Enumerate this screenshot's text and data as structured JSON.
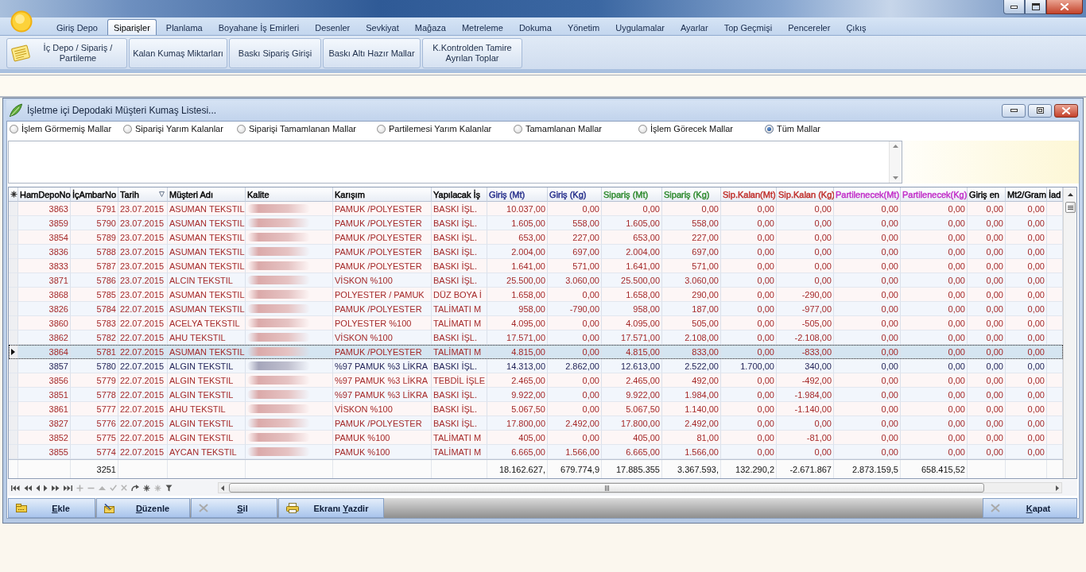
{
  "menu": {
    "tabs": [
      {
        "label": "Giriş Depo",
        "selected": false
      },
      {
        "label": "Siparişler",
        "selected": true
      },
      {
        "label": "Planlama",
        "selected": false
      },
      {
        "label": "Boyahane İş Emirleri",
        "selected": false
      },
      {
        "label": "Desenler",
        "selected": false
      },
      {
        "label": "Sevkiyat",
        "selected": false
      },
      {
        "label": "Mağaza",
        "selected": false
      },
      {
        "label": "Metreleme",
        "selected": false
      },
      {
        "label": "Dokuma",
        "selected": false
      },
      {
        "label": "Yönetim",
        "selected": false
      },
      {
        "label": "Uygulamalar",
        "selected": false
      },
      {
        "label": "Ayarlar",
        "selected": false
      },
      {
        "label": "Top Geçmişi",
        "selected": false
      },
      {
        "label": "Pencereler",
        "selected": false
      },
      {
        "label": "Çıkış",
        "selected": false
      }
    ]
  },
  "ribbon": {
    "buttons": [
      {
        "label": "İç Depo / Sipariş / Partileme",
        "kind": "icon"
      },
      {
        "label": "Kalan Kumaş Miktarları",
        "kind": "plain"
      },
      {
        "label": "Baskı Sipariş Girişi",
        "kind": "plain"
      },
      {
        "label": "Baskı Altı Hazır Mallar",
        "kind": "plain"
      },
      {
        "label": "K.Kontrolden Tamire Ayrılan Toplar",
        "kind": "plain"
      }
    ]
  },
  "window": {
    "title": "İşletme içi Depodaki Müşteri Kumaş Listesi..."
  },
  "filters": [
    {
      "label": "İşlem Görmemiş Mallar",
      "selected": false
    },
    {
      "label": "Siparişi Yarım Kalanlar",
      "selected": false
    },
    {
      "label": "Siparişi Tamamlanan Mallar",
      "selected": false
    },
    {
      "label": "Partilemesi Yarım Kalanlar",
      "selected": false
    },
    {
      "label": "Tamamlanan Mallar",
      "selected": false
    },
    {
      "label": "İşlem Görecek Mallar",
      "selected": false
    },
    {
      "label": "Tüm Mallar",
      "selected": true
    }
  ],
  "table": {
    "columns": [
      {
        "label": "HamDepoNo",
        "kind": "id",
        "color": "#000000",
        "sorted": false
      },
      {
        "label": "İçAmbarNo",
        "kind": "id",
        "color": "#000000",
        "sorted": false,
        "total": "3251"
      },
      {
        "label": "Tarih",
        "kind": "date",
        "color": "#000000",
        "sorted": true
      },
      {
        "label": "Müşteri Adı",
        "kind": "text",
        "color": "#000000",
        "sorted": false
      },
      {
        "label": "Kalite",
        "kind": "masked",
        "color": "#000000",
        "sorted": false
      },
      {
        "label": "Karışım",
        "kind": "text",
        "color": "#000000",
        "sorted": false
      },
      {
        "label": "Yapılacak İş",
        "kind": "text",
        "color": "#000000",
        "sorted": false
      },
      {
        "label": "Giriş (Mt)",
        "kind": "amount",
        "color": "#27308c",
        "sorted": false,
        "total": "18.162.627,"
      },
      {
        "label": "Giriş (Kg)",
        "kind": "amount",
        "color": "#27308c",
        "sorted": false,
        "total": "679.774,9"
      },
      {
        "label": "Sipariş (Mt)",
        "kind": "amount",
        "color": "#2f8a2f",
        "sorted": false,
        "total": "17.885.355"
      },
      {
        "label": "Sipariş (Kg)",
        "kind": "amount",
        "color": "#2f8a2f",
        "sorted": false,
        "total": "3.367.593,"
      },
      {
        "label": "Sip.Kalan(Mt)",
        "kind": "amount",
        "color": "#c0302c",
        "sorted": false,
        "total": "132.290,2"
      },
      {
        "label": "Sip.Kalan (Kg)",
        "kind": "amount",
        "color": "#c0302c",
        "sorted": false,
        "total": "-2.671.867"
      },
      {
        "label": "Partilenecek(Mt)",
        "kind": "amount",
        "color": "#c22fc9",
        "sorted": false,
        "total": "2.873.159,5"
      },
      {
        "label": "Partilenecek(Kg)",
        "kind": "amount",
        "color": "#c22fc9",
        "sorted": false,
        "total": "658.415,52"
      },
      {
        "label": "Giriş en",
        "kind": "amount",
        "color": "#000000",
        "sorted": false
      },
      {
        "label": "Mt2/Gram",
        "kind": "amount",
        "color": "#000000",
        "sorted": false
      },
      {
        "label": "İad",
        "kind": "blank",
        "color": "#000000",
        "sorted": false
      }
    ],
    "rows": [
      {
        "values": [
          "3863",
          "5791",
          "23.07.2015",
          "ASUMAN TEKSTIL",
          "PAMUK /POLYESTER",
          "BASKI İŞL.",
          "10.037,00",
          "0,00",
          "0,00",
          "0,00",
          "0,00",
          "0,00",
          "0,00",
          "0,00",
          "0,00",
          "0,00"
        ],
        "color": "#a52a2a",
        "selected": false
      },
      {
        "values": [
          "3859",
          "5790",
          "23.07.2015",
          "ASUMAN TEKSTIL",
          "PAMUK /POLYESTER",
          "BASKI İŞL.",
          "1.605,00",
          "558,00",
          "1.605,00",
          "558,00",
          "0,00",
          "0,00",
          "0,00",
          "0,00",
          "0,00",
          "0,00"
        ],
        "color": "#a52a2a",
        "selected": false
      },
      {
        "values": [
          "3854",
          "5789",
          "23.07.2015",
          "ASUMAN TEKSTIL",
          "PAMUK /POLYESTER",
          "BASKI İŞL.",
          "653,00",
          "227,00",
          "653,00",
          "227,00",
          "0,00",
          "0,00",
          "0,00",
          "0,00",
          "0,00",
          "0,00"
        ],
        "color": "#a52a2a",
        "selected": false
      },
      {
        "values": [
          "3836",
          "5788",
          "23.07.2015",
          "ASUMAN TEKSTIL",
          "PAMUK /POLYESTER",
          "BASKI İŞL.",
          "2.004,00",
          "697,00",
          "2.004,00",
          "697,00",
          "0,00",
          "0,00",
          "0,00",
          "0,00",
          "0,00",
          "0,00"
        ],
        "color": "#a52a2a",
        "selected": false
      },
      {
        "values": [
          "3833",
          "5787",
          "23.07.2015",
          "ASUMAN TEKSTIL",
          "PAMUK /POLYESTER",
          "BASKI İŞL.",
          "1.641,00",
          "571,00",
          "1.641,00",
          "571,00",
          "0,00",
          "0,00",
          "0,00",
          "0,00",
          "0,00",
          "0,00"
        ],
        "color": "#a52a2a",
        "selected": false
      },
      {
        "values": [
          "3871",
          "5786",
          "23.07.2015",
          "ALCIN TEKSTIL",
          "VİSKON %100",
          "BASKI İŞL.",
          "25.500,00",
          "3.060,00",
          "25.500,00",
          "3.060,00",
          "0,00",
          "0,00",
          "0,00",
          "0,00",
          "0,00",
          "0,00"
        ],
        "color": "#a52a2a",
        "selected": false
      },
      {
        "values": [
          "3868",
          "5785",
          "23.07.2015",
          "ASUMAN TEKSTIL",
          "POLYESTER / PAMUK",
          "DÜZ BOYA İ",
          "1.658,00",
          "0,00",
          "1.658,00",
          "290,00",
          "0,00",
          "-290,00",
          "0,00",
          "0,00",
          "0,00",
          "0,00"
        ],
        "color": "#a52a2a",
        "selected": false
      },
      {
        "values": [
          "3826",
          "5784",
          "22.07.2015",
          "ASUMAN TEKSTIL",
          "PAMUK /POLYESTER",
          "TALİMATI M",
          "958,00",
          "-790,00",
          "958,00",
          "187,00",
          "0,00",
          "-977,00",
          "0,00",
          "0,00",
          "0,00",
          "0,00"
        ],
        "color": "#a52a2a",
        "selected": false
      },
      {
        "values": [
          "3860",
          "5783",
          "22.07.2015",
          "ACELYA TEKSTIL",
          "POLYESTER %100",
          "TALİMATI M",
          "4.095,00",
          "0,00",
          "4.095,00",
          "505,00",
          "0,00",
          "-505,00",
          "0,00",
          "0,00",
          "0,00",
          "0,00"
        ],
        "color": "#a52a2a",
        "selected": false
      },
      {
        "values": [
          "3862",
          "5782",
          "22.07.2015",
          "AHU TEKSTIL",
          "VİSKON %100",
          "BASKI İŞL.",
          "17.571,00",
          "0,00",
          "17.571,00",
          "2.108,00",
          "0,00",
          "-2.108,00",
          "0,00",
          "0,00",
          "0,00",
          "0,00"
        ],
        "color": "#a52a2a",
        "selected": false
      },
      {
        "values": [
          "3864",
          "5781",
          "22.07.2015",
          "ASUMAN TEKSTIL",
          "PAMUK /POLYESTER",
          "TALİMATI M",
          "4.815,00",
          "0,00",
          "4.815,00",
          "833,00",
          "0,00",
          "-833,00",
          "0,00",
          "0,00",
          "0,00",
          "0,00"
        ],
        "color": "#a52a2a",
        "selected": true
      },
      {
        "values": [
          "3857",
          "5780",
          "22.07.2015",
          "ALGIN TEKSTIL",
          "%97 PAMUK %3 LİKRA",
          "BASKI İŞL.",
          "14.313,00",
          "2.862,00",
          "12.613,00",
          "2.522,00",
          "1.700,00",
          "340,00",
          "0,00",
          "0,00",
          "0,00",
          "0,00"
        ],
        "color": "#1f2055",
        "selected": false
      },
      {
        "values": [
          "3856",
          "5779",
          "22.07.2015",
          "ALGIN TEKSTIL",
          "%97 PAMUK %3 LİKRA",
          "TEBDİL İŞLE",
          "2.465,00",
          "0,00",
          "2.465,00",
          "492,00",
          "0,00",
          "-492,00",
          "0,00",
          "0,00",
          "0,00",
          "0,00"
        ],
        "color": "#a52a2a",
        "selected": false
      },
      {
        "values": [
          "3851",
          "5778",
          "22.07.2015",
          "ALGIN TEKSTIL",
          "%97 PAMUK %3 LİKRA",
          "BASKI İŞL.",
          "9.922,00",
          "0,00",
          "9.922,00",
          "1.984,00",
          "0,00",
          "-1.984,00",
          "0,00",
          "0,00",
          "0,00",
          "0,00"
        ],
        "color": "#a52a2a",
        "selected": false
      },
      {
        "values": [
          "3861",
          "5777",
          "22.07.2015",
          "AHU TEKSTIL",
          "VİSKON %100",
          "BASKI İŞL.",
          "5.067,50",
          "0,00",
          "5.067,50",
          "1.140,00",
          "0,00",
          "-1.140,00",
          "0,00",
          "0,00",
          "0,00",
          "0,00"
        ],
        "color": "#a52a2a",
        "selected": false
      },
      {
        "values": [
          "3827",
          "5776",
          "22.07.2015",
          "ALGIN TEKSTIL",
          "PAMUK /POLYESTER",
          "BASKI İŞL.",
          "17.800,00",
          "2.492,00",
          "17.800,00",
          "2.492,00",
          "0,00",
          "0,00",
          "0,00",
          "0,00",
          "0,00",
          "0,00"
        ],
        "color": "#a52a2a",
        "selected": false
      },
      {
        "values": [
          "3852",
          "5775",
          "22.07.2015",
          "ALGIN TEKSTIL",
          "PAMUK %100",
          "TALİMATI M",
          "405,00",
          "0,00",
          "405,00",
          "81,00",
          "0,00",
          "-81,00",
          "0,00",
          "0,00",
          "0,00",
          "0,00"
        ],
        "color": "#a52a2a",
        "selected": false
      },
      {
        "values": [
          "3855",
          "5774",
          "22.07.2015",
          "AYCAN TEKSTIL",
          "PAMUK %100",
          "TALİMATI M",
          "6.665,00",
          "1.566,00",
          "6.665,00",
          "1.566,00",
          "0,00",
          "0,00",
          "0,00",
          "0,00",
          "0,00",
          "0,00"
        ],
        "color": "#a52a2a",
        "selected": false
      }
    ]
  },
  "navigator": {
    "buttons": [
      {
        "kind": "first",
        "disabled": false
      },
      {
        "kind": "prev_page",
        "disabled": false
      },
      {
        "kind": "prev",
        "disabled": false
      },
      {
        "kind": "next",
        "disabled": false
      },
      {
        "kind": "next_page",
        "disabled": false
      },
      {
        "kind": "last",
        "disabled": false
      },
      {
        "kind": "insert",
        "disabled": true
      },
      {
        "kind": "delete",
        "disabled": true
      },
      {
        "kind": "edit",
        "disabled": true
      },
      {
        "kind": "post",
        "disabled": true
      },
      {
        "kind": "cancel",
        "disabled": true
      },
      {
        "kind": "refresh",
        "disabled": false
      },
      {
        "kind": "bookmark",
        "disabled": false
      },
      {
        "kind": "goto_bookmark",
        "disabled": true
      },
      {
        "kind": "filter",
        "disabled": false
      }
    ]
  },
  "action_bar": {
    "buttons": [
      {
        "label": "Ekle",
        "kind": "add"
      },
      {
        "label": "Düzenle",
        "kind": "edit"
      },
      {
        "label": "Sil",
        "kind": "delete"
      },
      {
        "label": "Ekranı Yazdir",
        "kind": "print"
      }
    ],
    "close_button": {
      "label": "Kapat"
    }
  }
}
